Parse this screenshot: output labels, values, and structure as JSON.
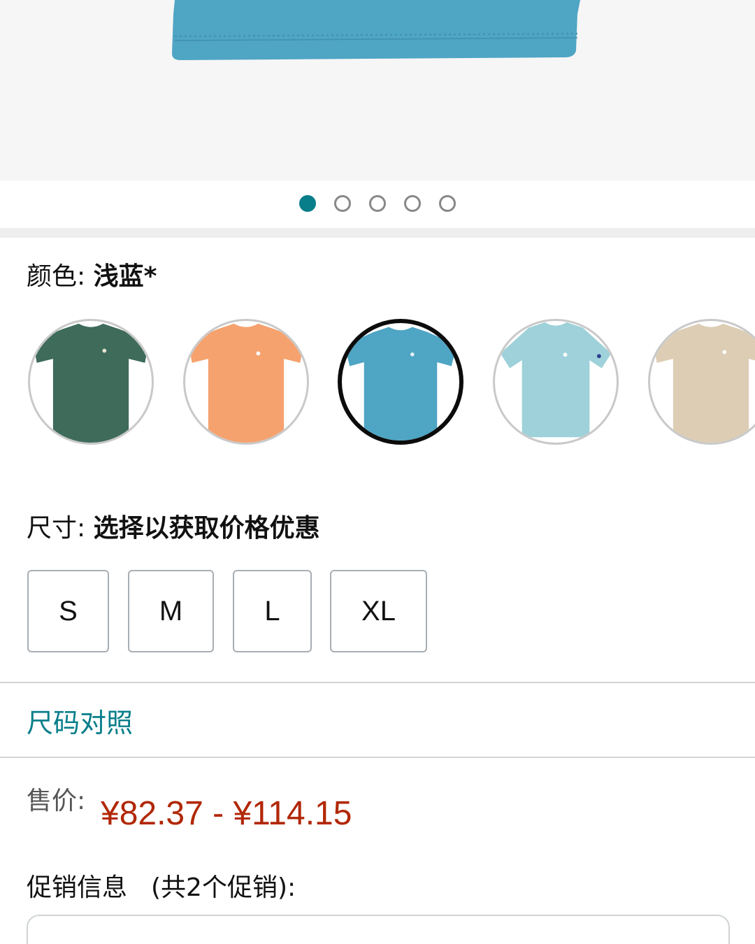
{
  "carousel": {
    "dot_count": 5,
    "active_index": 0,
    "active_color": "#087e8b"
  },
  "color": {
    "label": "颜色: ",
    "selected": "浅蓝*",
    "swatches": [
      {
        "name": "dark-green",
        "color": "#3e6b5a"
      },
      {
        "name": "orange",
        "color": "#f5a26e"
      },
      {
        "name": "light-blue",
        "color": "#4fa5c4",
        "selected": true
      },
      {
        "name": "pale-aqua",
        "color": "#9ed1d9"
      },
      {
        "name": "beige",
        "color": "#dccdb4"
      }
    ]
  },
  "size": {
    "label": "尺寸: ",
    "prompt": "选择以获取价格优惠",
    "options": [
      "S",
      "M",
      "L",
      "XL"
    ]
  },
  "size_chart_link": "尺码对照",
  "price": {
    "label": "售价:",
    "range": "¥82.37 - ¥114.15",
    "color": "#b12704"
  },
  "promo": {
    "label": "促销信息",
    "count": "(共2个促销):"
  }
}
